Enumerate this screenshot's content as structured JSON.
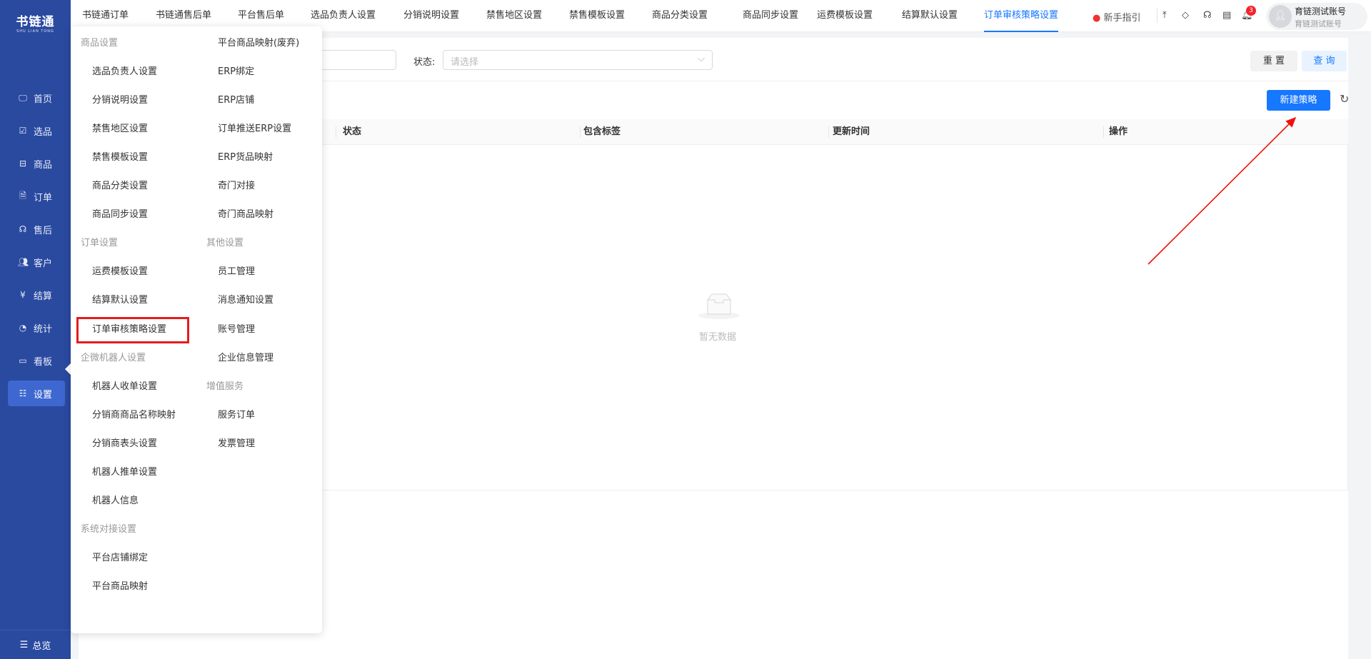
{
  "brand": {
    "name": "书链通",
    "sub": "SHU LIAN TONG",
    "color": "#2a4aa0"
  },
  "sidebar": {
    "items": [
      {
        "label": "首页",
        "icon": "monitor-icon"
      },
      {
        "label": "选品",
        "icon": "checklist-icon"
      },
      {
        "label": "商品",
        "icon": "box-icon"
      },
      {
        "label": "订单",
        "icon": "document-icon"
      },
      {
        "label": "售后",
        "icon": "headset-icon"
      },
      {
        "label": "客户",
        "icon": "users-icon"
      },
      {
        "label": "结算",
        "icon": "yen-icon"
      },
      {
        "label": "统计",
        "icon": "pie-icon"
      },
      {
        "label": "看板",
        "icon": "board-icon"
      },
      {
        "label": "设置",
        "icon": "sliders-icon",
        "active": true
      }
    ],
    "overview": "总览"
  },
  "header": {
    "tabs": [
      "书链通订单",
      "书链通售后单",
      "平台售后单",
      "选品负责人设置",
      "分销说明设置",
      "禁售地区设置",
      "禁售模板设置",
      "商品分类设置",
      "商品同步设置",
      "运费模板设置",
      "结算默认设置",
      "订单审核策略设置"
    ],
    "active_tab": "订单审核策略设置",
    "guide": "新手指引",
    "notification_count": "3",
    "user": {
      "name": "育链测试账号",
      "account": "育链测试账号"
    },
    "accent": "#1677ff"
  },
  "filter": {
    "status_label": "状态:",
    "status_placeholder": "请选择",
    "reset": "重 置",
    "query": "查 询"
  },
  "toolbar": {
    "new": "新建策略"
  },
  "table": {
    "columns": [
      "状态",
      "包含标签",
      "更新时间",
      "操作"
    ],
    "empty": "暂无数据"
  },
  "menu": {
    "left": [
      {
        "label": "商品设置",
        "group": true
      },
      {
        "label": "选品负责人设置"
      },
      {
        "label": "分销说明设置"
      },
      {
        "label": "禁售地区设置"
      },
      {
        "label": "禁售模板设置"
      },
      {
        "label": "商品分类设置"
      },
      {
        "label": "商品同步设置"
      },
      {
        "label": "订单设置",
        "group": true
      },
      {
        "label": "运费模板设置"
      },
      {
        "label": "结算默认设置"
      },
      {
        "label": "订单审核策略设置",
        "highlighted": true
      },
      {
        "label": "企微机器人设置",
        "group": true
      },
      {
        "label": "机器人收单设置"
      },
      {
        "label": "分销商商品名称映射"
      },
      {
        "label": "分销商表头设置"
      },
      {
        "label": "机器人推单设置"
      },
      {
        "label": "机器人信息"
      },
      {
        "label": "系统对接设置",
        "group": true
      },
      {
        "label": "平台店铺绑定"
      },
      {
        "label": "平台商品映射"
      }
    ],
    "right": [
      {
        "label": "平台商品映射(废弃)"
      },
      {
        "label": "ERP绑定"
      },
      {
        "label": "ERP店铺"
      },
      {
        "label": "订单推送ERP设置"
      },
      {
        "label": "ERP货品映射"
      },
      {
        "label": "奇门对接"
      },
      {
        "label": "奇门商品映射"
      },
      {
        "label": "其他设置",
        "group": true
      },
      {
        "label": "员工管理"
      },
      {
        "label": "消息通知设置"
      },
      {
        "label": "账号管理"
      },
      {
        "label": "企业信息管理"
      },
      {
        "label": "增值服务",
        "group": true
      },
      {
        "label": "服务订单"
      },
      {
        "label": "发票管理"
      }
    ]
  },
  "annotation": {
    "highlight_color": "#e51c1c"
  }
}
